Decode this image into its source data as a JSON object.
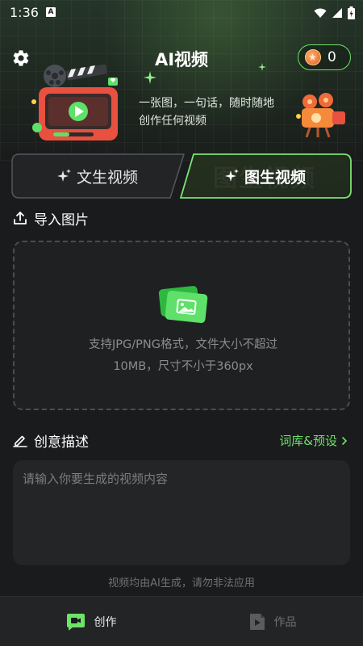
{
  "status_bar": {
    "time": "1:36",
    "badge": "A"
  },
  "header": {
    "title": "AI视频",
    "coin_count": "0"
  },
  "hero": {
    "subtitle_line1": "一张图，一句话，随时随地",
    "subtitle_line2": "创作任何视频"
  },
  "tabs": [
    {
      "label": "文生视频",
      "active": false
    },
    {
      "label": "图生视频",
      "active": true
    }
  ],
  "upload": {
    "section_title": "导入图片",
    "hint_line1": "支持JPG/PNG格式，文件大小不超过",
    "hint_line2": "10MB，尺寸不小于360px"
  },
  "description": {
    "section_title": "创意描述",
    "library_link": "词库&预设",
    "value": "",
    "placeholder": "请输入你要生成的视频内容"
  },
  "disclaimer": "视频均由AI生成，请勿非法应用",
  "bottom_nav": {
    "create_label": "创作",
    "works_label": "作品"
  },
  "colors": {
    "accent": "#6ee36a",
    "background": "#1a1b1c",
    "card": "#242527"
  },
  "icons": {
    "settings": "gear-icon",
    "coin": "coin-icon",
    "upload": "upload-icon",
    "edit": "pencil-icon",
    "create": "video-camera-icon",
    "works": "play-file-icon"
  }
}
